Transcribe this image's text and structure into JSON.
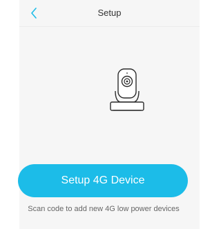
{
  "header": {
    "title": "Setup",
    "back_icon": "chevron-left-icon"
  },
  "illustration": {
    "icon": "ptz-camera-icon"
  },
  "main": {
    "primary_button_label": "Setup 4G Device",
    "hint_text": "Scan code to add new 4G low power devices"
  },
  "colors": {
    "accent": "#1cbce8",
    "background": "#f6f6f6"
  }
}
